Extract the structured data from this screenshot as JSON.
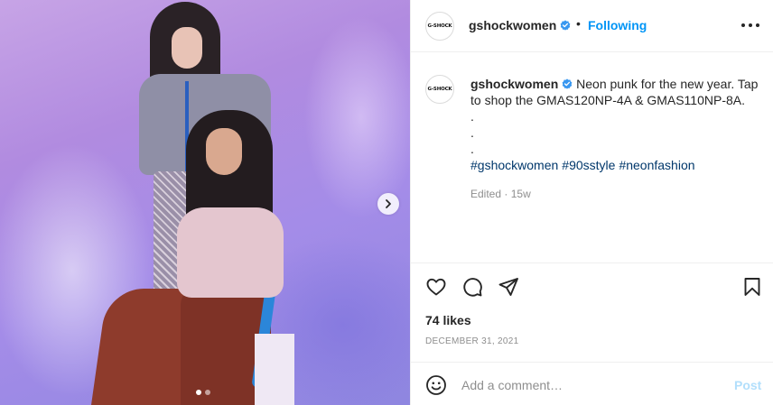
{
  "post": {
    "account": {
      "username": "gshockwomen",
      "avatar_text": "G-SHOCK",
      "verified_icon": "verified-badge-icon",
      "follow_separator": "•",
      "follow_status": "Following"
    },
    "caption": {
      "text": "Neon punk for the new year. Tap to shop the GMAS120NP-4A & GMAS110NP-8A.",
      "dots": [
        ".",
        ".",
        "."
      ],
      "hashtags": [
        "#gshockwomen",
        "#90sstyle",
        "#neonfashion"
      ],
      "edited_label": "Edited",
      "meta_separator": "·",
      "age": "15w"
    },
    "likes": "74 likes",
    "date": "DECEMBER 31, 2021",
    "carousel": {
      "current_slide": 1,
      "total_slides": 2,
      "next_icon": "chevron-right-icon"
    },
    "comment": {
      "placeholder": "Add a comment…",
      "post_label": "Post"
    },
    "icons": [
      "heart-icon",
      "comment-icon",
      "share-icon",
      "bookmark-icon",
      "emoji-icon",
      "more-options-icon"
    ],
    "colors": {
      "link_blue": "#0095f6",
      "hashtag_blue": "#00376b",
      "post_disabled": "#b2dffc",
      "muted_text": "#8e8e8e"
    }
  }
}
